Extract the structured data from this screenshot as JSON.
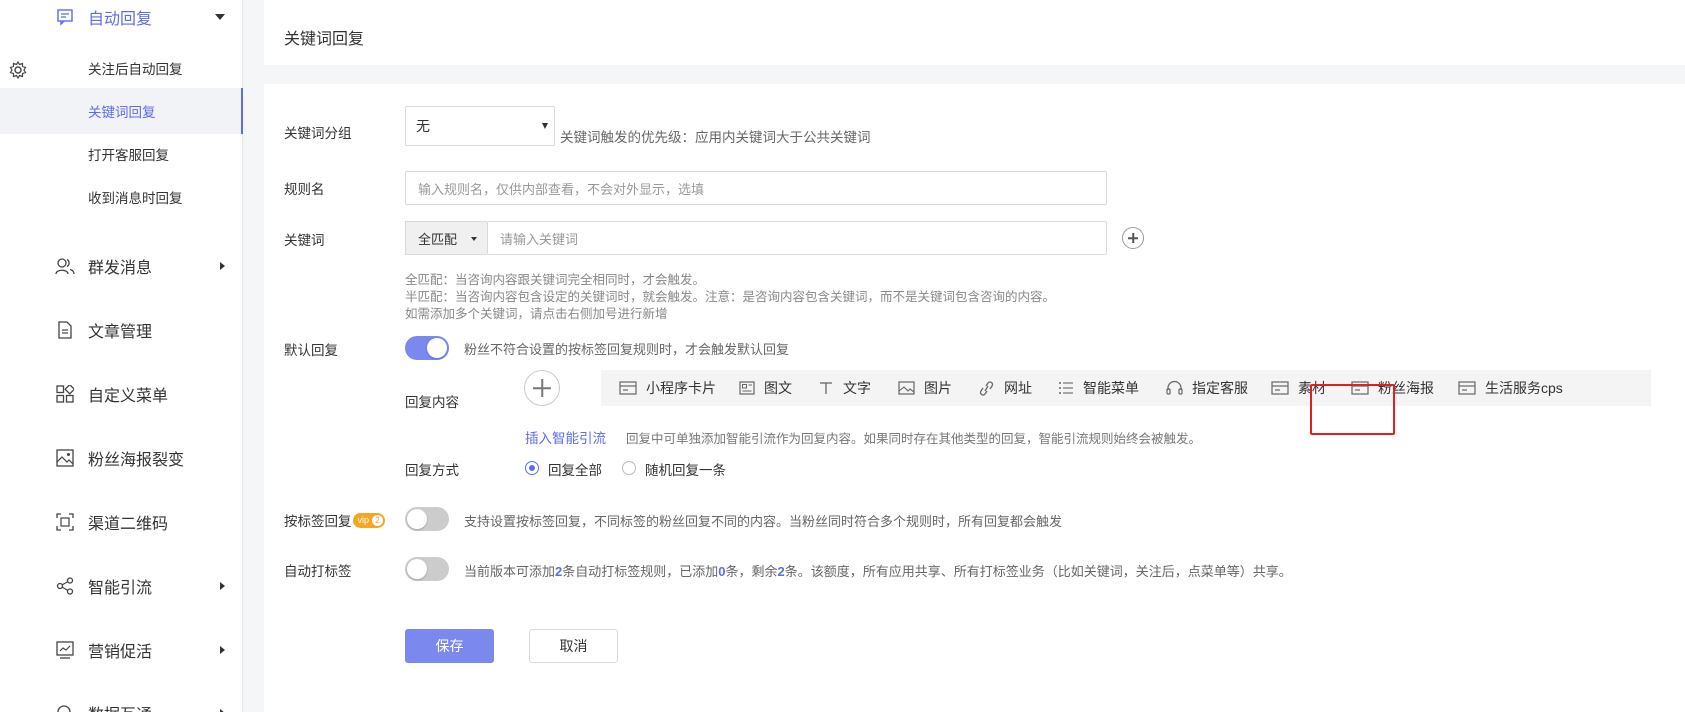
{
  "sidebar": {
    "auto_reply": "自动回复",
    "sub_items": [
      "关注后自动回复",
      "关键词回复",
      "打开客服回复",
      "收到消息时回复"
    ],
    "menu_items": [
      "群发消息",
      "文章管理",
      "自定义菜单",
      "粉丝海报裂变",
      "渠道二维码",
      "智能引流",
      "营销促活",
      "数据互通"
    ]
  },
  "header": {
    "title": "关键词回复"
  },
  "form": {
    "group_label": "关键词分组",
    "group_value": "无",
    "group_hint": "关键词触发的优先级：应用内关键词大于公共关键词",
    "rule_label": "规则名",
    "rule_placeholder": "输入规则名，仅供内部查看，不会对外显示，选填",
    "keyword_label": "关键词",
    "match_value": "全匹配",
    "keyword_placeholder": "请输入关键词",
    "notes": [
      "全匹配：当咨询内容跟关键词完全相同时，才会触发。",
      "半匹配：当咨询内容包含设定的关键词时，就会触发。注意：是咨询内容包含关键词，而不是关键词包含咨询的内容。",
      "如需添加多个关键词，请点击右侧加号进行新增"
    ],
    "default_label": "默认回复",
    "default_hint": "粉丝不符合设置的按标签回复规则时，才会触发默认回复",
    "default_on": true,
    "content_label": "回复内容",
    "content_types": [
      "小程序卡片",
      "图文",
      "文字",
      "图片",
      "网址",
      "智能菜单",
      "指定客服",
      "素材",
      "粉丝海报",
      "生活服务cps"
    ],
    "smart_link": "插入智能引流",
    "smart_hint": "回复中可单独添加智能引流作为回复内容。如果同时存在其他类型的回复，智能引流规则始终会被触发。",
    "mode_label": "回复方式",
    "mode_options": [
      "回复全部",
      "随机回复一条"
    ],
    "tag_label": "按标签回复",
    "vip_text": "vip",
    "vip_num": "2",
    "tag_hint": "支持设置按标签回复，不同标签的粉丝回复不同的内容。当粉丝同时符合多个规则时，所有回复都会触发",
    "tag_on": false,
    "autotag_label": "自动打标签",
    "autotag_hint": {
      "p1": "当前版本可添加",
      "n1": "2",
      "p2": "条自动打标签规则，已添加",
      "n2": "0",
      "p3": "条，剩余",
      "n3": "2",
      "p4": "条。该额度，所有应用共享、所有打标签业务（比如关键词，关注后，点菜单等）共享。"
    },
    "autotag_on": false,
    "save": "保存",
    "cancel": "取消"
  },
  "colors": {
    "accent": "#5b6cf0",
    "button": "#7b88ee",
    "highlight": "#e02020"
  }
}
